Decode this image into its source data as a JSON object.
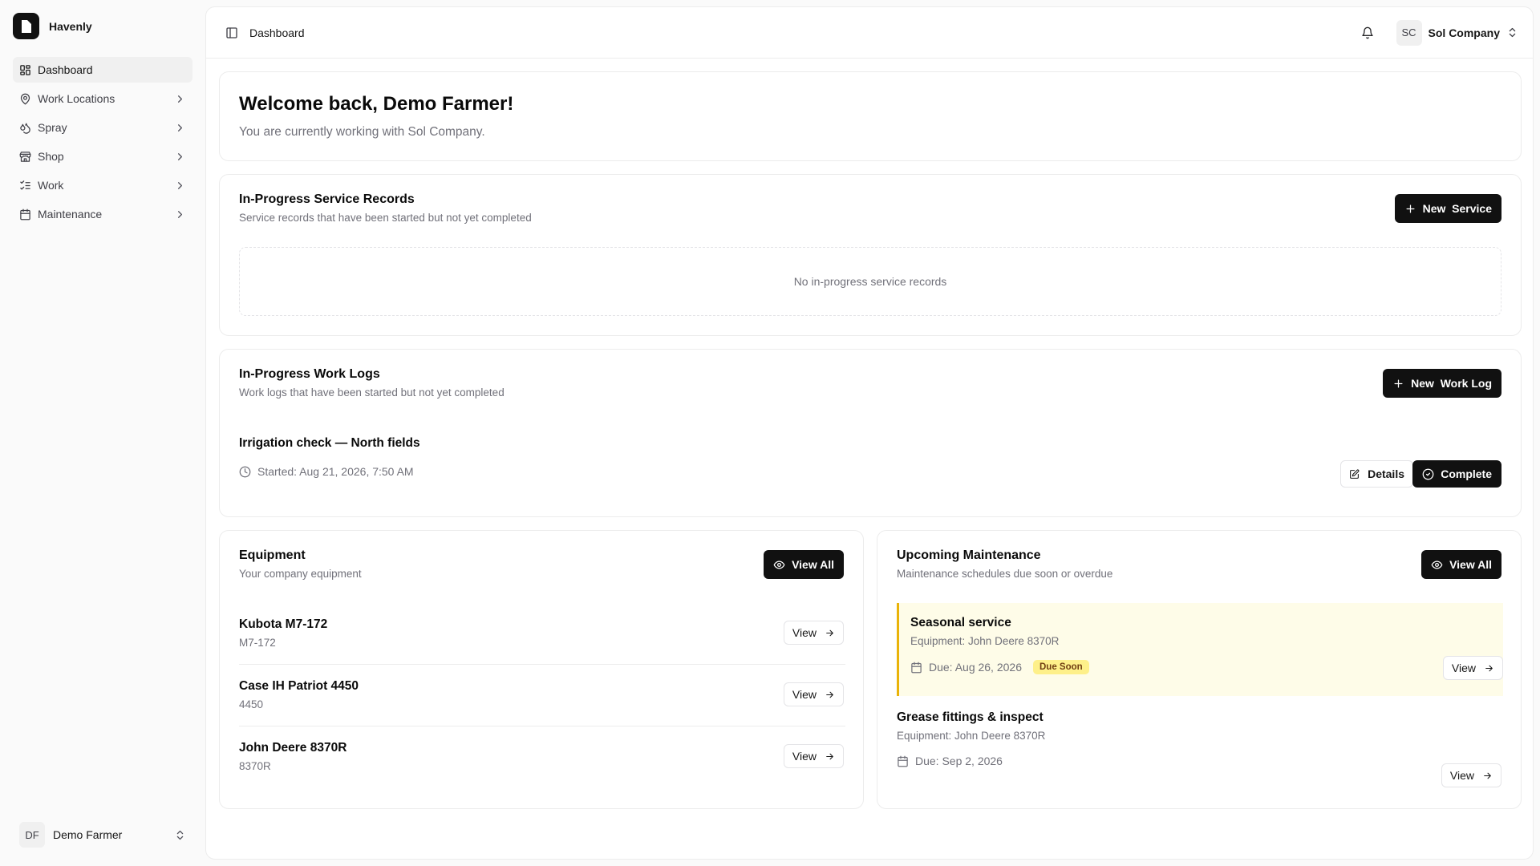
{
  "app": {
    "name": "Havenly"
  },
  "sidebar": {
    "items": [
      {
        "label": "Dashboard",
        "icon": "layout-grid-icon"
      },
      {
        "label": "Work Locations",
        "icon": "map-pin-icon"
      },
      {
        "label": "Spray",
        "icon": "droplets-icon"
      },
      {
        "label": "Shop",
        "icon": "store-icon"
      },
      {
        "label": "Work",
        "icon": "list-checks-icon"
      },
      {
        "label": "Maintenance",
        "icon": "calendar-icon"
      }
    ],
    "user": {
      "initials": "DF",
      "name": "Demo Farmer"
    }
  },
  "header": {
    "breadcrumb": "Dashboard",
    "company_initials": "SC",
    "company_name": "Sol Company"
  },
  "welcome": {
    "title": "Welcome back, Demo Farmer!",
    "subtitle": "You are currently working with Sol Company."
  },
  "service_records": {
    "title": "In-Progress Service Records",
    "description": "Service records that have been started but not yet completed",
    "button": "New  Service",
    "empty": "No in-progress service records"
  },
  "work_logs": {
    "title": "In-Progress Work Logs",
    "description": "Work logs that have been started but not yet completed",
    "button": "New  Work Log",
    "items": [
      {
        "title": "Irrigation check — North fields",
        "started": "Started: Aug 21, 2026, 7:50 AM",
        "details_label": "Details",
        "complete_label": "Complete"
      }
    ]
  },
  "equipment": {
    "title": "Equipment",
    "description": "Your company equipment",
    "button": "View All",
    "items": [
      {
        "name": "Kubota M7-172",
        "model": "M7-172",
        "view_label": "View"
      },
      {
        "name": "Case IH Patriot 4450",
        "model": "4450",
        "view_label": "View"
      },
      {
        "name": "John Deere 8370R",
        "model": "8370R",
        "view_label": "View"
      }
    ]
  },
  "maintenance": {
    "title": "Upcoming Maintenance",
    "description": "Maintenance schedules due soon or overdue",
    "button": "View All",
    "items": [
      {
        "name": "Seasonal service",
        "equipment": "Equipment: John Deere 8370R",
        "due": "Due: Aug 26, 2026",
        "badge": "Due Soon",
        "view_label": "View"
      },
      {
        "name": "Grease fittings & inspect",
        "equipment": "Equipment: John Deere 8370R",
        "due": "Due: Sep 2, 2026",
        "view_label": "View"
      }
    ]
  },
  "colors": {
    "primary": "#111111",
    "muted_text": "#71717a",
    "border": "#ececec",
    "warning_bg": "#fefce8",
    "warning_border": "#eab308",
    "badge_bg": "#fef08a"
  }
}
